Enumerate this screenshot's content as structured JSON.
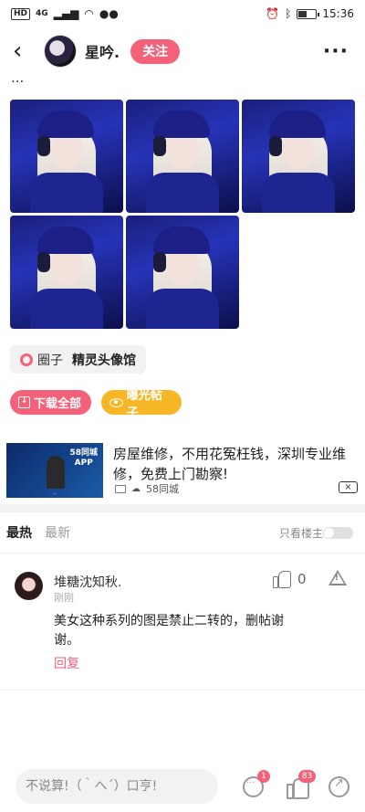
{
  "statusbar": {
    "hd": "HD",
    "network": "4G",
    "time": "15:36"
  },
  "header": {
    "username": "星吟.",
    "follow_label": "关注"
  },
  "post": {
    "cut_text": "...",
    "photo_count": 5
  },
  "circle": {
    "label": "圈子",
    "name": "精灵头像馆"
  },
  "actions": {
    "download_label": "下载全部",
    "expose_label": "曝光帖子"
  },
  "ad": {
    "thumb_title": "58同城\nAPP",
    "thumb_caption": "...",
    "text": "房屋维修，不用花冤枉钱，深圳专业维修，免费上门勘察!",
    "source": "58同城"
  },
  "comments": {
    "tab_hot": "最热",
    "tab_new": "最新",
    "only_op": "只看楼主",
    "items": [
      {
        "name": "堆糖沈知秋.",
        "time": "刚刚",
        "likes": "0",
        "text": "美女这种系列的图是禁止二转的，删帖谢谢。",
        "reply": "回复"
      }
    ]
  },
  "bottombar": {
    "placeholder": "不说算!（｀へ´）口亨!",
    "comment_badge": "1",
    "like_badge": "83"
  },
  "colors": {
    "accent": "#f4627a",
    "expose": "#f7b626"
  }
}
